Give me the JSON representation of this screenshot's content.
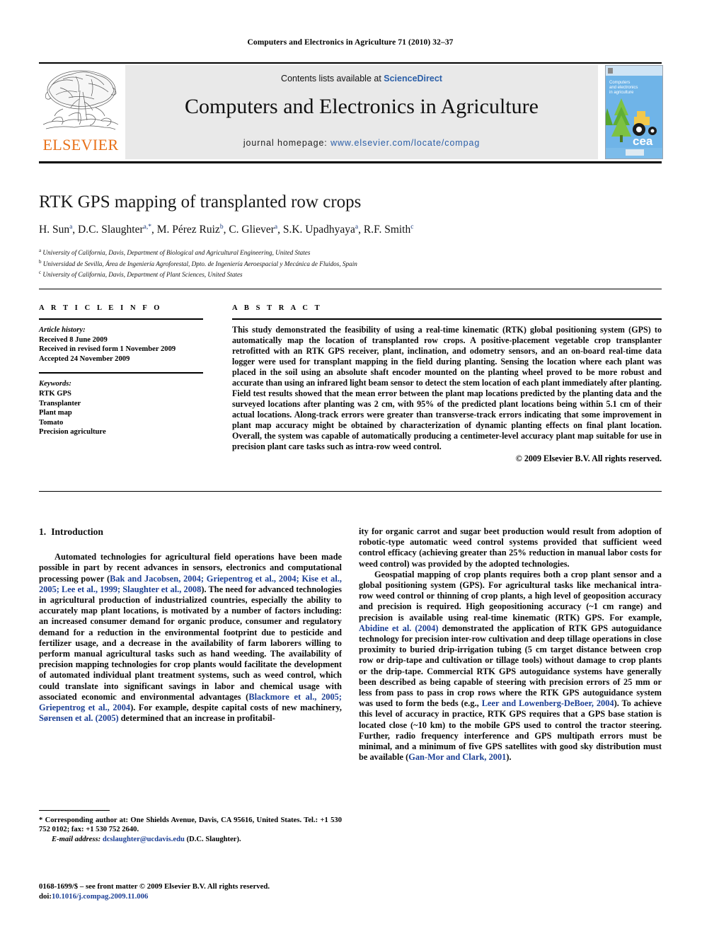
{
  "running_head": "Computers and Electronics in Agriculture 71 (2010) 32–37",
  "banner": {
    "publisher_name": "ELSEVIER",
    "contents_prefix": "Contents lists available at ",
    "contents_link": "ScienceDirect",
    "journal_title": "Computers and Electronics in Agriculture",
    "homepage_prefix": "journal homepage:",
    "homepage_url": "www.elsevier.com/locate/compag",
    "cover_line1": "Computers",
    "cover_line2": "and electronics",
    "cover_line3": "in agriculture",
    "cover_logo_text": "cea",
    "accent_orange": "#E8711A",
    "link_blue": "#2b5fa8",
    "banner_gray": "#e9e9e9"
  },
  "article": {
    "title": "RTK GPS mapping of transplanted row crops",
    "authors_html": "H. Sun<sup>a</sup>, D.C. Slaughter<sup>a,<span class=\"star\">*</span></sup>, M. Pérez Ruiz<sup>b</sup>, C. Gliever<sup>a</sup>, S.K. Upadhyaya<sup>a</sup>, R.F. Smith<sup>c</sup>",
    "affiliations": [
      {
        "marker": "a",
        "text": "University of California, Davis, Department of Biological and Agricultural Engineering, United States"
      },
      {
        "marker": "b",
        "text": "Universidad de Sevilla, Área de Ingeniería Agroforestal, Dpto. de Ingeniería Aeroespacial y Mecánica de Fluidos, Spain"
      },
      {
        "marker": "c",
        "text": "University of California, Davis, Department of Plant Sciences, United States"
      }
    ]
  },
  "article_info": {
    "heading": "A R T I C L E    I N F O",
    "history_label": "Article history:",
    "history": [
      "Received 8 June 2009",
      "Received in revised form 1 November 2009",
      "Accepted 24 November 2009"
    ],
    "keywords_label": "Keywords:",
    "keywords": [
      "RTK GPS",
      "Transplanter",
      "Plant map",
      "Tomato",
      "Precision agriculture"
    ]
  },
  "abstract": {
    "heading": "A B S T R A C T",
    "body": "This study demonstrated the feasibility of using a real-time kinematic (RTK) global positioning system (GPS) to automatically map the location of transplanted row crops. A positive-placement vegetable crop transplanter retrofitted with an RTK GPS receiver, plant, inclination, and odometry sensors, and an on-board real-time data logger were used for transplant mapping in the field during planting. Sensing the location where each plant was placed in the soil using an absolute shaft encoder mounted on the planting wheel proved to be more robust and accurate than using an infrared light beam sensor to detect the stem location of each plant immediately after planting. Field test results showed that the mean error between the plant map locations predicted by the planting data and the surveyed locations after planting was 2 cm, with 95% of the predicted plant locations being within 5.1 cm of their actual locations. Along-track errors were greater than transverse-track errors indicating that some improvement in plant map accuracy might be obtained by characterization of dynamic planting effects on final plant location. Overall, the system was capable of automatically producing a centimeter-level accuracy plant map suitable for use in precision plant care tasks such as intra-row weed control.",
    "copyright": "© 2009 Elsevier B.V. All rights reserved."
  },
  "body": {
    "section1_number": "1.",
    "section1_title": "Introduction",
    "left_para1_html": "Automated technologies for agricultural field operations have been made possible in part by recent advances in sensors, electronics and computational processing power (<span class=\"cite\">Bak and Jacobsen, 2004; Griepentrog et al., 2004; Kise et al., 2005; Lee et al., 1999; Slaughter et al., 2008</span>). The need for advanced technologies in agricultural production of industrialized countries, especially the ability to accurately map plant locations, is motivated by a number of factors including: an increased consumer demand for organic produce, consumer and regulatory demand for a reduction in the environmental footprint due to pesticide and fertilizer usage, and a decrease in the availability of farm laborers willing to perform manual agricultural tasks such as hand weeding. The availability of precision mapping technologies for crop plants would facilitate the development of automated individual plant treatment systems, such as weed control, which could translate into significant savings in labor and chemical usage with associated economic and environmental advantages (<span class=\"cite\">Blackmore et al., 2005; Griepentrog et al., 2004</span>). For example, despite capital costs of new machinery, <span class=\"cite\">Sørensen et al. (2005)</span> determined that an increase in profitabil-",
    "right_para1_html": "ity for organic carrot and sugar beet production would result from adoption of robotic-type automatic weed control systems provided that sufficient weed control efficacy (achieving greater than 25% reduction in manual labor costs for weed control) was provided by the adopted technologies.",
    "right_para2_html": "Geospatial mapping of crop plants requires both a crop plant sensor and a global positioning system (GPS). For agricultural tasks like mechanical intra-row weed control or thinning of crop plants, a high level of geoposition accuracy and precision is required. High geopositioning accuracy (~1 cm range) and precision is available using real-time kinematic (RTK) GPS. For example, <span class=\"cite\">Abidine et al. (2004)</span> demonstrated the application of RTK GPS autoguidance technology for precision inter-row cultivation and deep tillage operations in close proximity to buried drip-irrigation tubing (5 cm target distance between crop row or drip-tape and cultivation or tillage tools) without damage to crop plants or the drip-tape. Commercial RTK GPS autoguidance systems have generally been described as being capable of steering with precision errors of 25 mm or less from pass to pass in crop rows where the RTK GPS autoguidance system was used to form the beds (e.g., <span class=\"cite\">Leer and Lowenberg-DeBoer, 2004</span>). To achieve this level of accuracy in practice, RTK GPS requires that a GPS base station is located close (~10 km) to the mobile GPS used to control the tractor steering. Further, radio frequency interference and GPS multipath errors must be minimal, and a minimum of five GPS satellites with good sky distribution must be available (<span class=\"cite\">Gan-Mor and Clark, 2001</span>)."
  },
  "footnotes": {
    "corresponding_html": "<span class=\"ind\">* Corresponding author at: One Shields Avenue, Davis, CA 95616, United States. Tel.: +1 530 752 0102; fax: +1 530 752 2640.</span>",
    "email_label": "E-mail address:",
    "email_address": "dcslaughter@ucdavis.edu",
    "email_suffix": " (D.C. Slaughter).",
    "issn_line": "0168-1699/$ – see front matter © 2009 Elsevier B.V. All rights reserved.",
    "doi_label": "doi:",
    "doi_value": "10.1016/j.compag.2009.11.006"
  }
}
